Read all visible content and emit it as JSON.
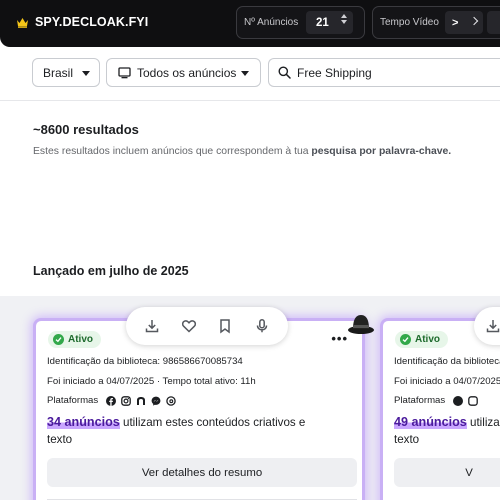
{
  "header": {
    "brand": "SPY.DECLOAK.FYI",
    "anuncios_label": "Nº Anúncios",
    "anuncios_value": "21",
    "tempo_label": "Tempo Vídeo",
    "tempo_comparator": ">"
  },
  "filters": {
    "country": "Brasil",
    "ad_type": "Todos os anúncios",
    "search_value": "Free Shipping"
  },
  "results": {
    "count": "~8600 resultados",
    "description_prefix": "Estes resultados incluem anúncios que correspondem à tua ",
    "description_bold": "pesquisa por palavra-chave."
  },
  "section": {
    "launched": "Lançado em julho de 2025"
  },
  "cards": [
    {
      "status": "Ativo",
      "library_id": "Identificação da biblioteca: 986586670085734",
      "started": "Foi iniciado a 04/07/2025 · Tempo total ativo: 11h",
      "platforms_label": "Plataformas",
      "ads_count": "34 anúncios",
      "ads_suffix": " utilizam estes conteúdos criativos e texto",
      "more": "•••",
      "button": "Ver detalhes do resumo"
    },
    {
      "status": "Ativo",
      "library_id": "Identificação da biblioteca:",
      "started": "Foi iniciado a 04/07/2025",
      "platforms_label": "Plataformas",
      "ads_count": "49 anúncios",
      "ads_suffix": " utiliza",
      "ads_suffix_line2": "texto",
      "button": "V"
    }
  ],
  "icons": {
    "brand": "crown-icon",
    "actions": [
      "download-icon",
      "heart-icon",
      "bookmark-icon",
      "microphone-icon"
    ],
    "platforms": [
      "facebook-icon",
      "instagram-icon",
      "audience-network-icon",
      "messenger-icon",
      "threads-icon"
    ],
    "spy": "spy-hat-icon"
  },
  "colors": {
    "accent": "#c9b0f5",
    "highlight": "#c9a6ff",
    "status_green": "#32a84a",
    "topbar": "#0f0f11"
  }
}
